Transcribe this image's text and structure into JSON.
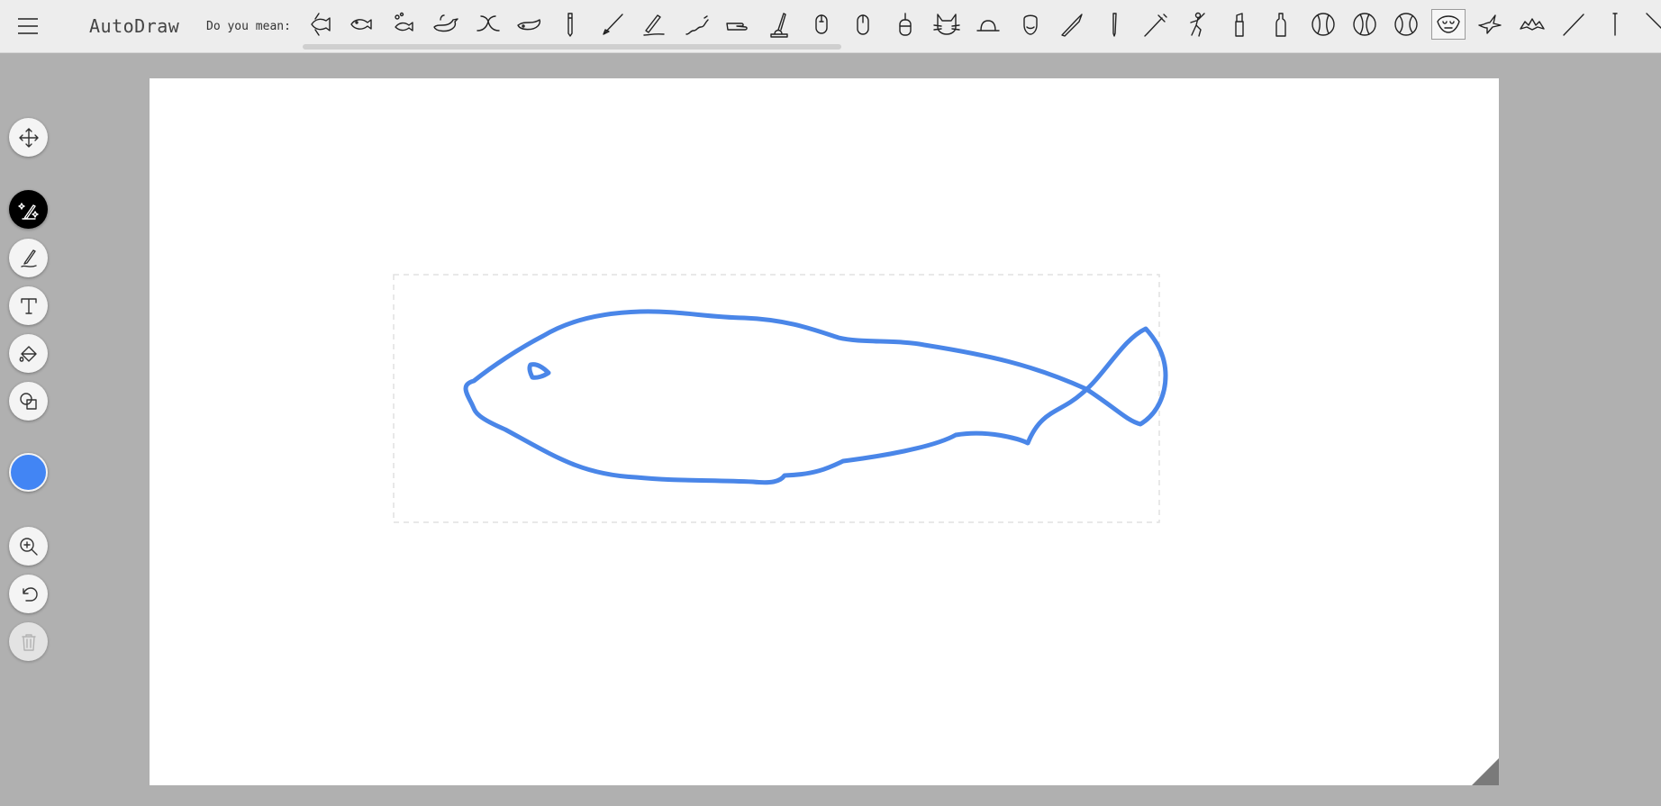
{
  "header": {
    "app_title": "AutoDraw",
    "suggestions_label": "Do you mean:"
  },
  "suggestions": [
    {
      "icon": "angelfish-icon"
    },
    {
      "icon": "fish-icon"
    },
    {
      "icon": "fish-bubbles-icon"
    },
    {
      "icon": "whale-spout-icon"
    },
    {
      "icon": "whale-tail-icon"
    },
    {
      "icon": "whale-icon"
    },
    {
      "icon": "pencil-icon"
    },
    {
      "icon": "line-stroke-icon"
    },
    {
      "icon": "pen-writing-icon"
    },
    {
      "icon": "snake-icon"
    },
    {
      "icon": "hand-icon"
    },
    {
      "icon": "inkwell-pen-icon"
    },
    {
      "icon": "mouse-icon"
    },
    {
      "icon": "computer-mouse-icon"
    },
    {
      "icon": "mouse-wired-icon"
    },
    {
      "icon": "cat-face-icon"
    },
    {
      "icon": "hat-icon"
    },
    {
      "icon": "face-beard-icon"
    },
    {
      "icon": "knife-icon"
    },
    {
      "icon": "pen-icon"
    },
    {
      "icon": "syringe-icon"
    },
    {
      "icon": "baseball-player-icon"
    },
    {
      "icon": "lipstick-icon"
    },
    {
      "icon": "bottle-icon"
    },
    {
      "icon": "baseball-icon"
    },
    {
      "icon": "ball-icon"
    },
    {
      "icon": "softball-icon"
    },
    {
      "icon": "face-mask-icon",
      "selected": true
    },
    {
      "icon": "bird-icon"
    },
    {
      "icon": "bat-icon"
    },
    {
      "icon": "wand-icon"
    },
    {
      "icon": "stick-icon"
    },
    {
      "icon": "line-diagonal-icon"
    }
  ],
  "tools": [
    {
      "name": "move-tool",
      "icon": "move-arrows-icon"
    },
    {
      "name": "autodraw-tool",
      "icon": "autodraw-sparkle-pen-icon",
      "active": true
    },
    {
      "name": "draw-tool",
      "icon": "pencil-draw-icon"
    },
    {
      "name": "type-tool",
      "icon": "text-t-icon"
    },
    {
      "name": "fill-tool",
      "icon": "paint-bucket-icon"
    },
    {
      "name": "shape-tool",
      "icon": "shapes-icon"
    },
    {
      "name": "zoom-tool",
      "icon": "zoom-in-icon"
    },
    {
      "name": "undo-tool",
      "icon": "undo-icon"
    },
    {
      "name": "delete-tool",
      "icon": "trash-icon",
      "disabled": true
    }
  ],
  "colors": {
    "selected_color": "#4285f4",
    "stroke": "#4a86e8"
  }
}
